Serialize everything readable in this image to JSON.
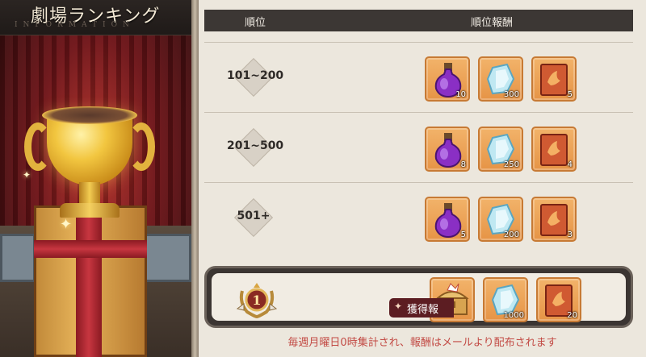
{
  "left_panel": {
    "title": "劇場ランキング",
    "subtitle": "INFORMATION"
  },
  "table": {
    "header_rank": "順位",
    "header_reward": "順位報酬",
    "rows": [
      {
        "rank": "101~200",
        "rewards": [
          {
            "icon": "purple-potion-icon",
            "qty": "10"
          },
          {
            "icon": "blue-crystal-icon",
            "qty": "300"
          },
          {
            "icon": "red-ticket-icon",
            "qty": "5"
          }
        ]
      },
      {
        "rank": "201~500",
        "rewards": [
          {
            "icon": "purple-potion-icon",
            "qty": "8"
          },
          {
            "icon": "blue-crystal-icon",
            "qty": "250"
          },
          {
            "icon": "red-ticket-icon",
            "qty": "4"
          }
        ]
      },
      {
        "rank": "501+",
        "rewards": [
          {
            "icon": "purple-potion-icon",
            "qty": "5"
          },
          {
            "icon": "blue-crystal-icon",
            "qty": "200"
          },
          {
            "icon": "red-ticket-icon",
            "qty": "3"
          }
        ]
      }
    ]
  },
  "my_rank": {
    "rank": "1",
    "rewards": [
      {
        "icon": "treasure-chest-icon",
        "qty": ""
      },
      {
        "icon": "blue-crystal-icon",
        "qty": "1000"
      },
      {
        "icon": "red-ticket-icon",
        "qty": "20"
      }
    ]
  },
  "acquire_button": "獲得報",
  "footer_note": "毎週月曜日0時集計され、報酬はメールより配布されます",
  "colors": {
    "header_bg": "#3c3734",
    "reward_bg": "#e69446",
    "footer_text": "#c24a44",
    "acquire_bg": "#5c1d22"
  }
}
